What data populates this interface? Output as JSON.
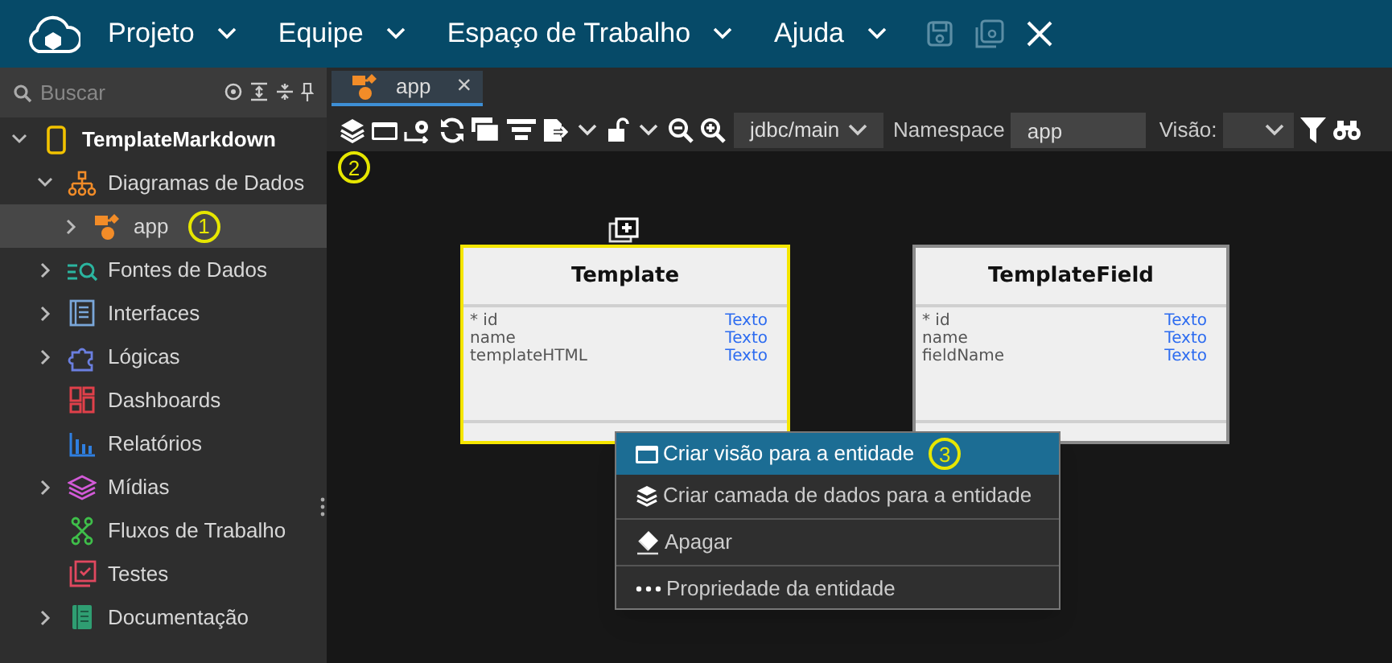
{
  "menu_bar": {
    "items": [
      {
        "label": "Projeto"
      },
      {
        "label": "Equipe"
      },
      {
        "label": "Espaço de Trabalho"
      },
      {
        "label": "Ajuda"
      }
    ]
  },
  "sidebar": {
    "search": {
      "placeholder": "Buscar"
    },
    "tree": [
      {
        "label": "TemplateMarkdown",
        "kind": "project",
        "color": "#f2c200",
        "expanded": true,
        "selected": false,
        "children": [
          {
            "label": "Diagramas de Dados",
            "kind": "diagrams",
            "color": "#f28c28",
            "expanded": true,
            "selected": false,
            "children": [
              {
                "label": "app",
                "kind": "diagram",
                "color": "#f28c28",
                "expanded": false,
                "selected": true,
                "marker": "1"
              }
            ]
          },
          {
            "label": "Fontes de Dados",
            "kind": "sources",
            "color": "#2bb5a0",
            "expanded": false,
            "selected": false
          },
          {
            "label": "Interfaces",
            "kind": "interfaces",
            "color": "#7aa7d9",
            "expanded": false,
            "selected": false
          },
          {
            "label": "Lógicas",
            "kind": "logic",
            "color": "#6b7fe0",
            "expanded": false,
            "selected": false
          },
          {
            "label": "Dashboards",
            "kind": "dashboards",
            "color": "#e0404a",
            "selected": false
          },
          {
            "label": "Relatórios",
            "kind": "reports",
            "color": "#2f7fe0",
            "selected": false
          },
          {
            "label": "Mídias",
            "kind": "media",
            "color": "#d35ad8",
            "expanded": false,
            "selected": false
          },
          {
            "label": "Fluxos de Trabalho",
            "kind": "flows",
            "color": "#3fbf4a",
            "selected": false
          },
          {
            "label": "Testes",
            "kind": "tests",
            "color": "#e0485f",
            "selected": false
          },
          {
            "label": "Documentação",
            "kind": "docs",
            "color": "#2f9e72",
            "expanded": false,
            "selected": false
          }
        ]
      }
    ]
  },
  "tabs": [
    {
      "label": "app",
      "selected": true,
      "close": "×"
    }
  ],
  "toolbar": {
    "toolbar_marker": "2",
    "connection": "jdbc/main",
    "namespace_label": "Namespace",
    "namespace": "app",
    "view_label": "Visão:"
  },
  "entities": [
    {
      "name": "Template",
      "selected": true,
      "fields": [
        {
          "name": "* id",
          "type": "Texto"
        },
        {
          "name": "name",
          "type": "Texto"
        },
        {
          "name": "templateHTML",
          "type": "Texto"
        }
      ]
    },
    {
      "name": "TemplateField",
      "selected": false,
      "fields": [
        {
          "name": "* id",
          "type": "Texto"
        },
        {
          "name": "name",
          "type": "Texto"
        },
        {
          "name": "fieldName",
          "type": "Texto"
        }
      ]
    }
  ],
  "context_menu": [
    {
      "label": "Criar visão para a entidade",
      "kind": "window",
      "selected": true,
      "marker": "3"
    },
    {
      "label": "Criar camada de dados para a entidade",
      "kind": "layers",
      "selected": false
    },
    {
      "label": "Apagar",
      "kind": "eraser",
      "selected": false
    },
    {
      "label": "Propriedade da entidade",
      "kind": "dots",
      "selected": false
    }
  ]
}
